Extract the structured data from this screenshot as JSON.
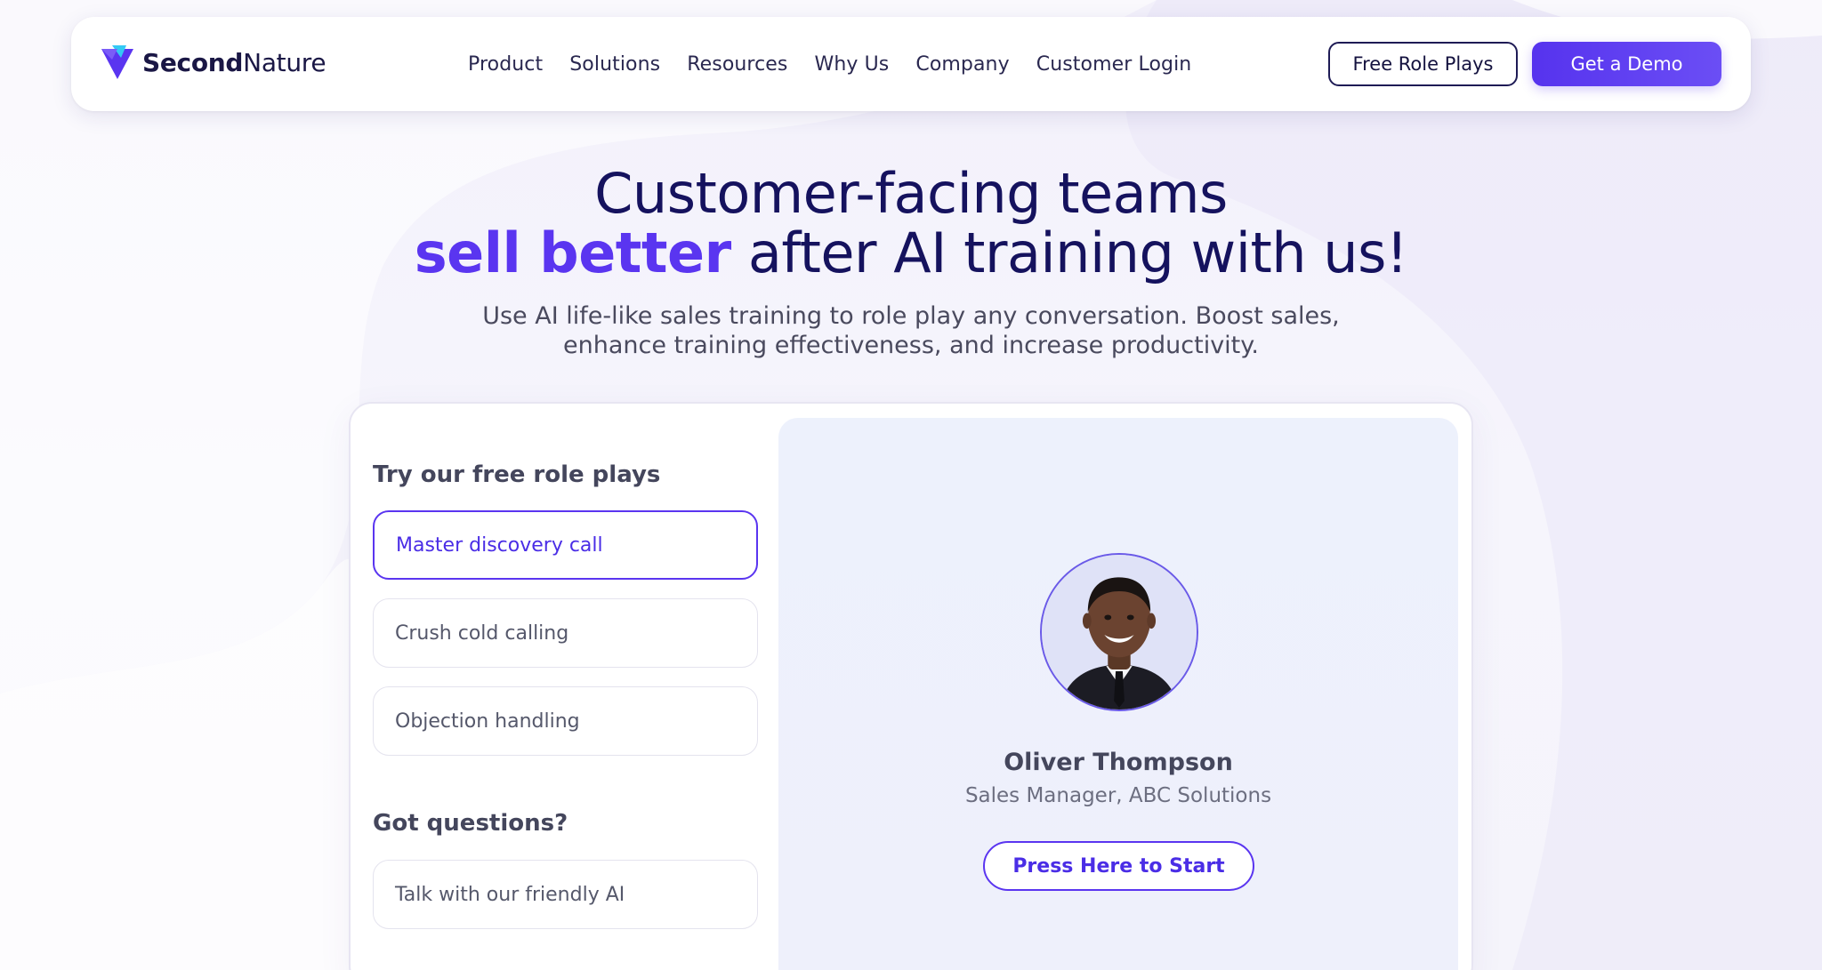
{
  "brand": {
    "name_bold": "Second",
    "name_regular": "Nature",
    "primary_color": "#5a35f0",
    "dark_color": "#15125e",
    "logo_icon": "secondnature-logo-icon"
  },
  "nav": {
    "items": [
      {
        "label": "Product"
      },
      {
        "label": "Solutions"
      },
      {
        "label": "Resources"
      },
      {
        "label": "Why Us"
      },
      {
        "label": "Company"
      },
      {
        "label": "Customer Login"
      }
    ],
    "free_role_plays_label": "Free Role Plays",
    "get_demo_label": "Get a Demo"
  },
  "hero": {
    "title_line1": "Customer-facing teams",
    "title_line2_accent": "sell better",
    "title_line2_rest": " after AI training with us!",
    "subtitle_line1": "Use AI life-like sales training to role play any conversation. Boost sales,",
    "subtitle_line2": "enhance training effectiveness, and increase productivity."
  },
  "roleplays": {
    "title": "Try our free role plays",
    "options": [
      {
        "label": "Master discovery call",
        "selected": true
      },
      {
        "label": "Crush cold calling",
        "selected": false
      },
      {
        "label": "Objection handling",
        "selected": false
      }
    ],
    "questions_title": "Got questions?",
    "questions_option": "Talk with our friendly AI"
  },
  "persona": {
    "avatar_icon": "person-avatar",
    "name": "Oliver Thompson",
    "role": "Sales Manager, ABC Solutions",
    "start_label": "Press Here to Start"
  }
}
